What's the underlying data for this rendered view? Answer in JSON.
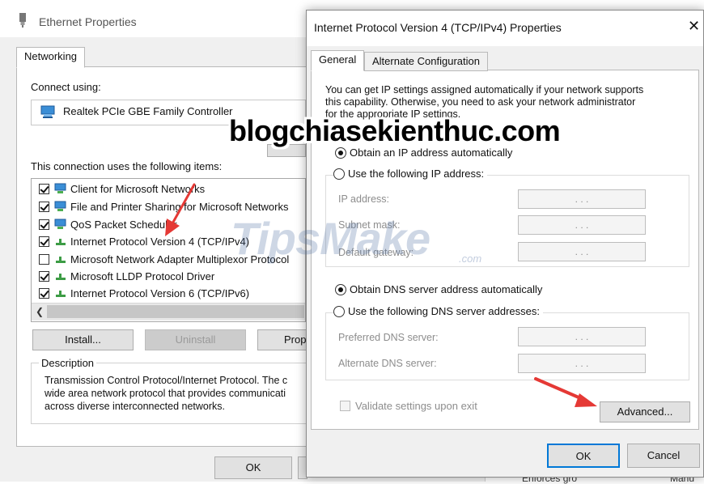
{
  "ethernet_window": {
    "title": "Ethernet Properties",
    "tab": "Networking",
    "connect_using_label": "Connect using:",
    "adapter_name": "Realtek PCIe GBE Family Controller",
    "items_label": "This connection uses the following items:",
    "items": [
      {
        "label": "Client for Microsoft Networks",
        "checked": true,
        "icon": "network-client-icon"
      },
      {
        "label": "File and Printer Sharing for Microsoft Networks",
        "checked": true,
        "icon": "network-client-icon"
      },
      {
        "label": "QoS Packet Scheduler",
        "checked": true,
        "icon": "network-client-icon"
      },
      {
        "label": "Internet Protocol Version 4 (TCP/IPv4)",
        "checked": true,
        "icon": "protocol-icon"
      },
      {
        "label": "Microsoft Network Adapter Multiplexor Protocol",
        "checked": false,
        "icon": "protocol-icon"
      },
      {
        "label": "Microsoft LLDP Protocol Driver",
        "checked": true,
        "icon": "protocol-icon"
      },
      {
        "label": "Internet Protocol Version 6 (TCP/IPv6)",
        "checked": true,
        "icon": "protocol-icon"
      }
    ],
    "install_label": "Install...",
    "uninstall_label": "Uninstall",
    "properties_label": "Prop",
    "description_label": "Description",
    "description_lines": [
      "Transmission Control Protocol/Internet Protocol. The c",
      "wide area network protocol that provides communicati",
      "across diverse interconnected networks."
    ],
    "ok_label": "OK"
  },
  "ipv4_dialog": {
    "title": "Internet Protocol Version 4 (TCP/IPv4) Properties",
    "tabs": [
      "General",
      "Alternate Configuration"
    ],
    "intro_lines": [
      "You can get IP settings assigned automatically if your network supports",
      "this capability. Otherwise, you need to ask your network administrator",
      "for the appropriate IP settings."
    ],
    "obtain_ip_auto": "Obtain an IP address automatically",
    "use_following_ip": "Use the following IP address:",
    "ip_address_label": "IP address:",
    "subnet_mask_label": "Subnet mask:",
    "default_gateway_label": "Default gateway:",
    "obtain_dns_auto": "Obtain DNS server address automatically",
    "use_following_dns": "Use the following DNS server addresses:",
    "preferred_dns_label": "Preferred DNS server:",
    "alternate_dns_label": "Alternate DNS server:",
    "validate_label": "Validate settings upon exit",
    "advanced_label": "Advanced...",
    "ok_label": "OK",
    "cancel_label": "Cancel",
    "ip_placeholder": ".     .     ."
  },
  "overlays": {
    "watermark": "blogchiasekienthuc.com",
    "tipsmake": "TipsMake",
    "tipsmake_suffix": ".com",
    "bg_text_1": "Enforces gro",
    "bg_text_2": "Manu"
  },
  "colors": {
    "arrow": "#e53935",
    "focus_border": "#0078d7",
    "window_bg": "#f0f0f0"
  }
}
